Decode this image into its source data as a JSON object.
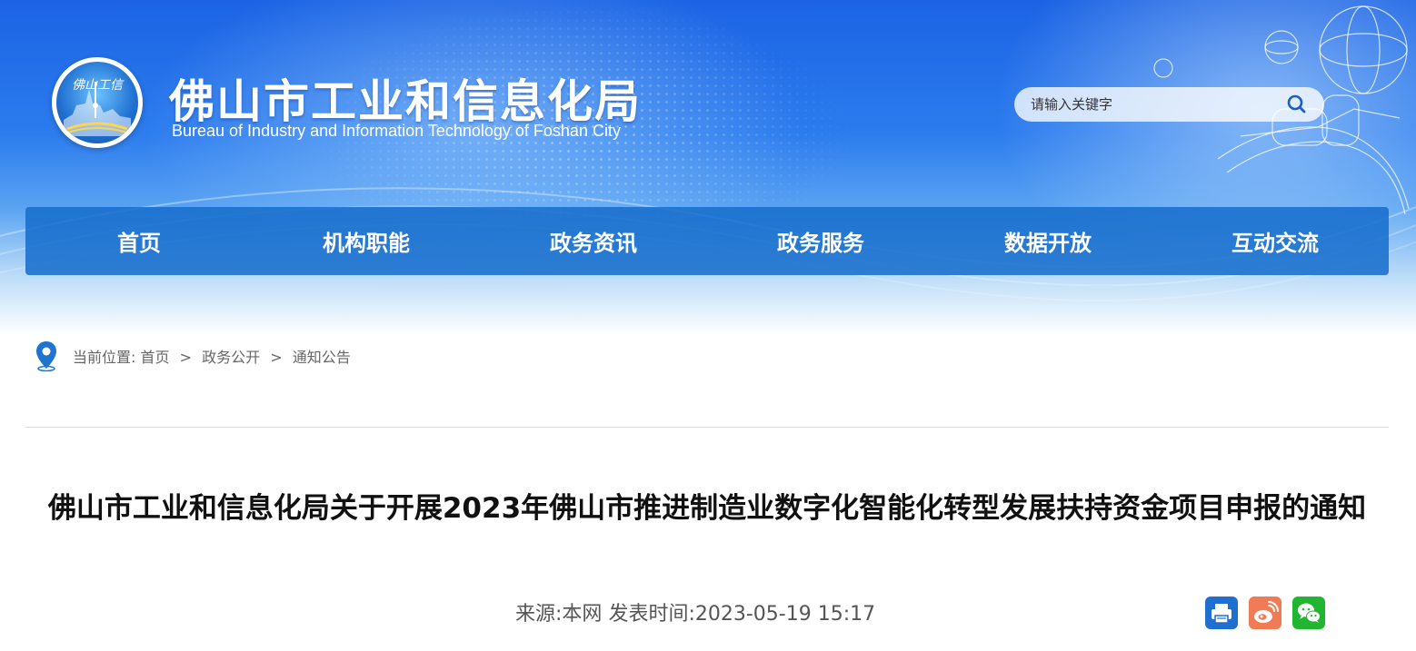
{
  "header": {
    "emblem_text": "佛山工信",
    "title": "佛山市工业和信息化局",
    "subtitle": "Bureau of Industry and Information Technology of Foshan City",
    "search": {
      "placeholder": "请输入关键字",
      "icon": "search-icon"
    }
  },
  "nav": {
    "items": [
      {
        "label": "首页"
      },
      {
        "label": "机构职能"
      },
      {
        "label": "政务资讯"
      },
      {
        "label": "政务服务"
      },
      {
        "label": "数据开放"
      },
      {
        "label": "互动交流"
      }
    ]
  },
  "breadcrumb": {
    "icon": "location-pin-icon",
    "prefix": "当前位置:",
    "items": [
      "首页",
      "政务公开",
      "通知公告"
    ],
    "separator": ">"
  },
  "article": {
    "title": "佛山市工业和信息化局关于开展2023年佛山市推进制造业数字化智能化转型发展扶持资金项目申报的通知",
    "source_label": "来源:",
    "source": "本网",
    "time_label": "发表时间:",
    "time": "2023-05-19 15:17"
  },
  "share": [
    {
      "icon": "print-icon",
      "color": "#1e6fd0"
    },
    {
      "icon": "weibo-icon",
      "color": "#f07b54"
    },
    {
      "icon": "wechat-icon",
      "color": "#22b531"
    }
  ],
  "colors": {
    "nav_bg": "#186ecd",
    "banner_blue": "#1b63e4",
    "title_text": "#111111",
    "meta_text": "#555555"
  }
}
